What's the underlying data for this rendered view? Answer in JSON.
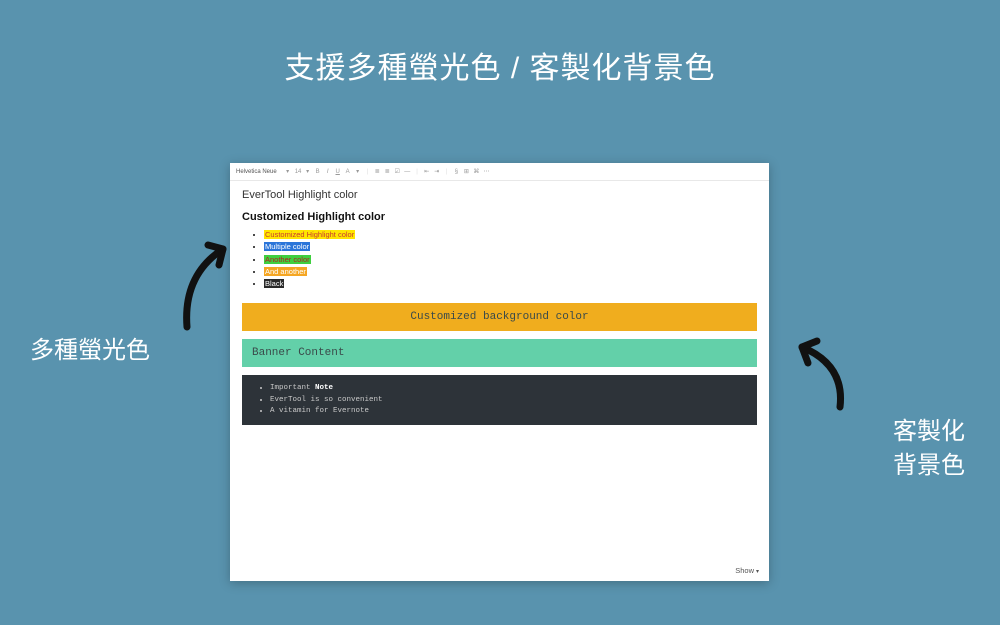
{
  "headline": "支援多種螢光色 / 客製化背景色",
  "label_left": "多種螢光色",
  "label_right_line1": "客製化",
  "label_right_line2": "背景色",
  "toolbar": {
    "font": "Helvetica Neue",
    "size": "14",
    "icons": [
      "B",
      "I",
      "U",
      "A",
      "▾",
      "≣",
      "≣",
      "☰",
      "—",
      "⇐",
      "⇒",
      "§",
      "⊞",
      "✓",
      "—",
      "𝛴"
    ]
  },
  "doc": {
    "title": "EverTool Highlight color",
    "section_heading": "Customized Highlight color",
    "items": [
      {
        "text": "Customized Highlight color",
        "bg": "#ffe600",
        "fg": "#c93a2f"
      },
      {
        "text": "Multiple color",
        "bg": "#2b75d9",
        "fg": "#ffffff"
      },
      {
        "text": "Another color",
        "bg": "#3fcf3f",
        "fg": "#b22222"
      },
      {
        "text": "And another",
        "bg": "#f5a623",
        "fg": "#ffffff"
      },
      {
        "text": "Black",
        "bg": "#2a2a2a",
        "fg": "#ffffff"
      }
    ],
    "banner1": {
      "text": "Customized background color",
      "bg": "#f0ad1e"
    },
    "banner2": {
      "text": "Banner Content",
      "bg": "#63d0a9"
    },
    "dark_items": [
      {
        "prefix": "Important ",
        "bold": "Note"
      },
      {
        "prefix": "EverTool is so convenient",
        "bold": ""
      },
      {
        "prefix": "A vitamin for Evernote",
        "bold": ""
      }
    ]
  },
  "show": "Show"
}
